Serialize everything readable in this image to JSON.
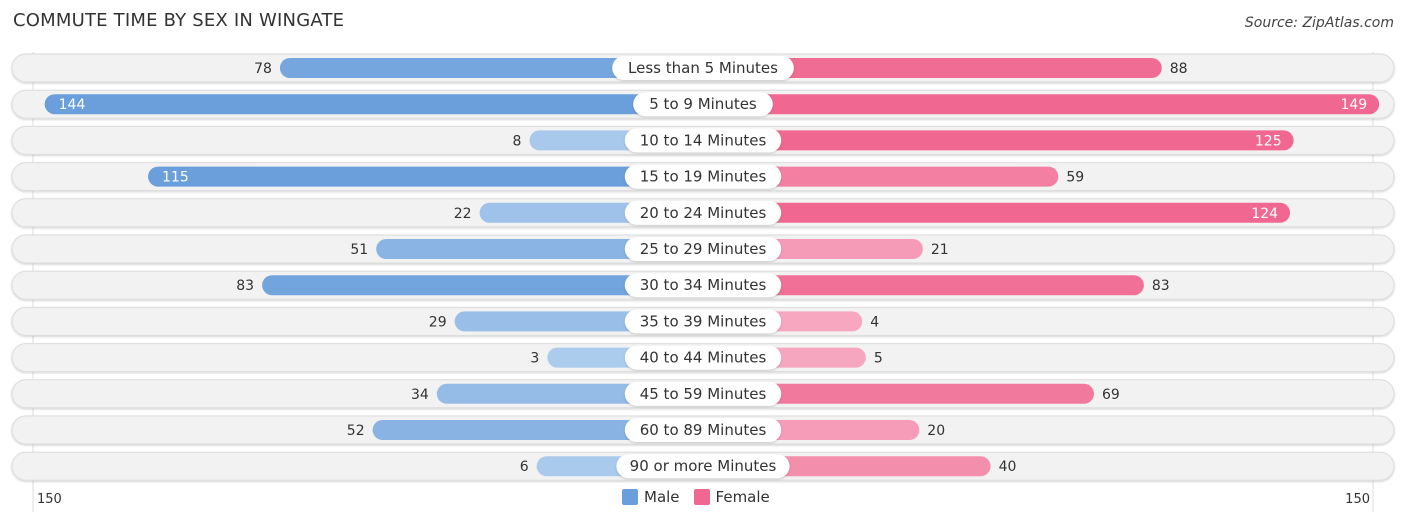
{
  "title": "COMMUTE TIME BY SEX IN WINGATE",
  "source": "Source: ZipAtlas.com",
  "legend": {
    "male": "Male",
    "female": "Female"
  },
  "colors": {
    "male_dark": "#6a9fdb",
    "male_light": "#aecdee",
    "female_dark": "#f06891",
    "female_light": "#f7aac2",
    "row_bg": "#f2f2f2"
  },
  "chart_data": {
    "type": "bar",
    "orientation": "horizontal-diverging",
    "title": "COMMUTE TIME BY SEX IN WINGATE",
    "categories": [
      "Less than 5 Minutes",
      "5 to 9 Minutes",
      "10 to 14 Minutes",
      "15 to 19 Minutes",
      "20 to 24 Minutes",
      "25 to 29 Minutes",
      "30 to 34 Minutes",
      "35 to 39 Minutes",
      "40 to 44 Minutes",
      "45 to 59 Minutes",
      "60 to 89 Minutes",
      "90 or more Minutes"
    ],
    "series": [
      {
        "name": "Male",
        "values": [
          78,
          144,
          8,
          115,
          22,
          51,
          83,
          29,
          3,
          34,
          52,
          6
        ]
      },
      {
        "name": "Female",
        "values": [
          88,
          149,
          125,
          59,
          124,
          21,
          83,
          4,
          5,
          69,
          20,
          40
        ]
      }
    ],
    "axis_min_label": "150",
    "axis_max_label": "150",
    "xlim": [
      -150,
      150
    ],
    "legend_position": "bottom-center"
  }
}
